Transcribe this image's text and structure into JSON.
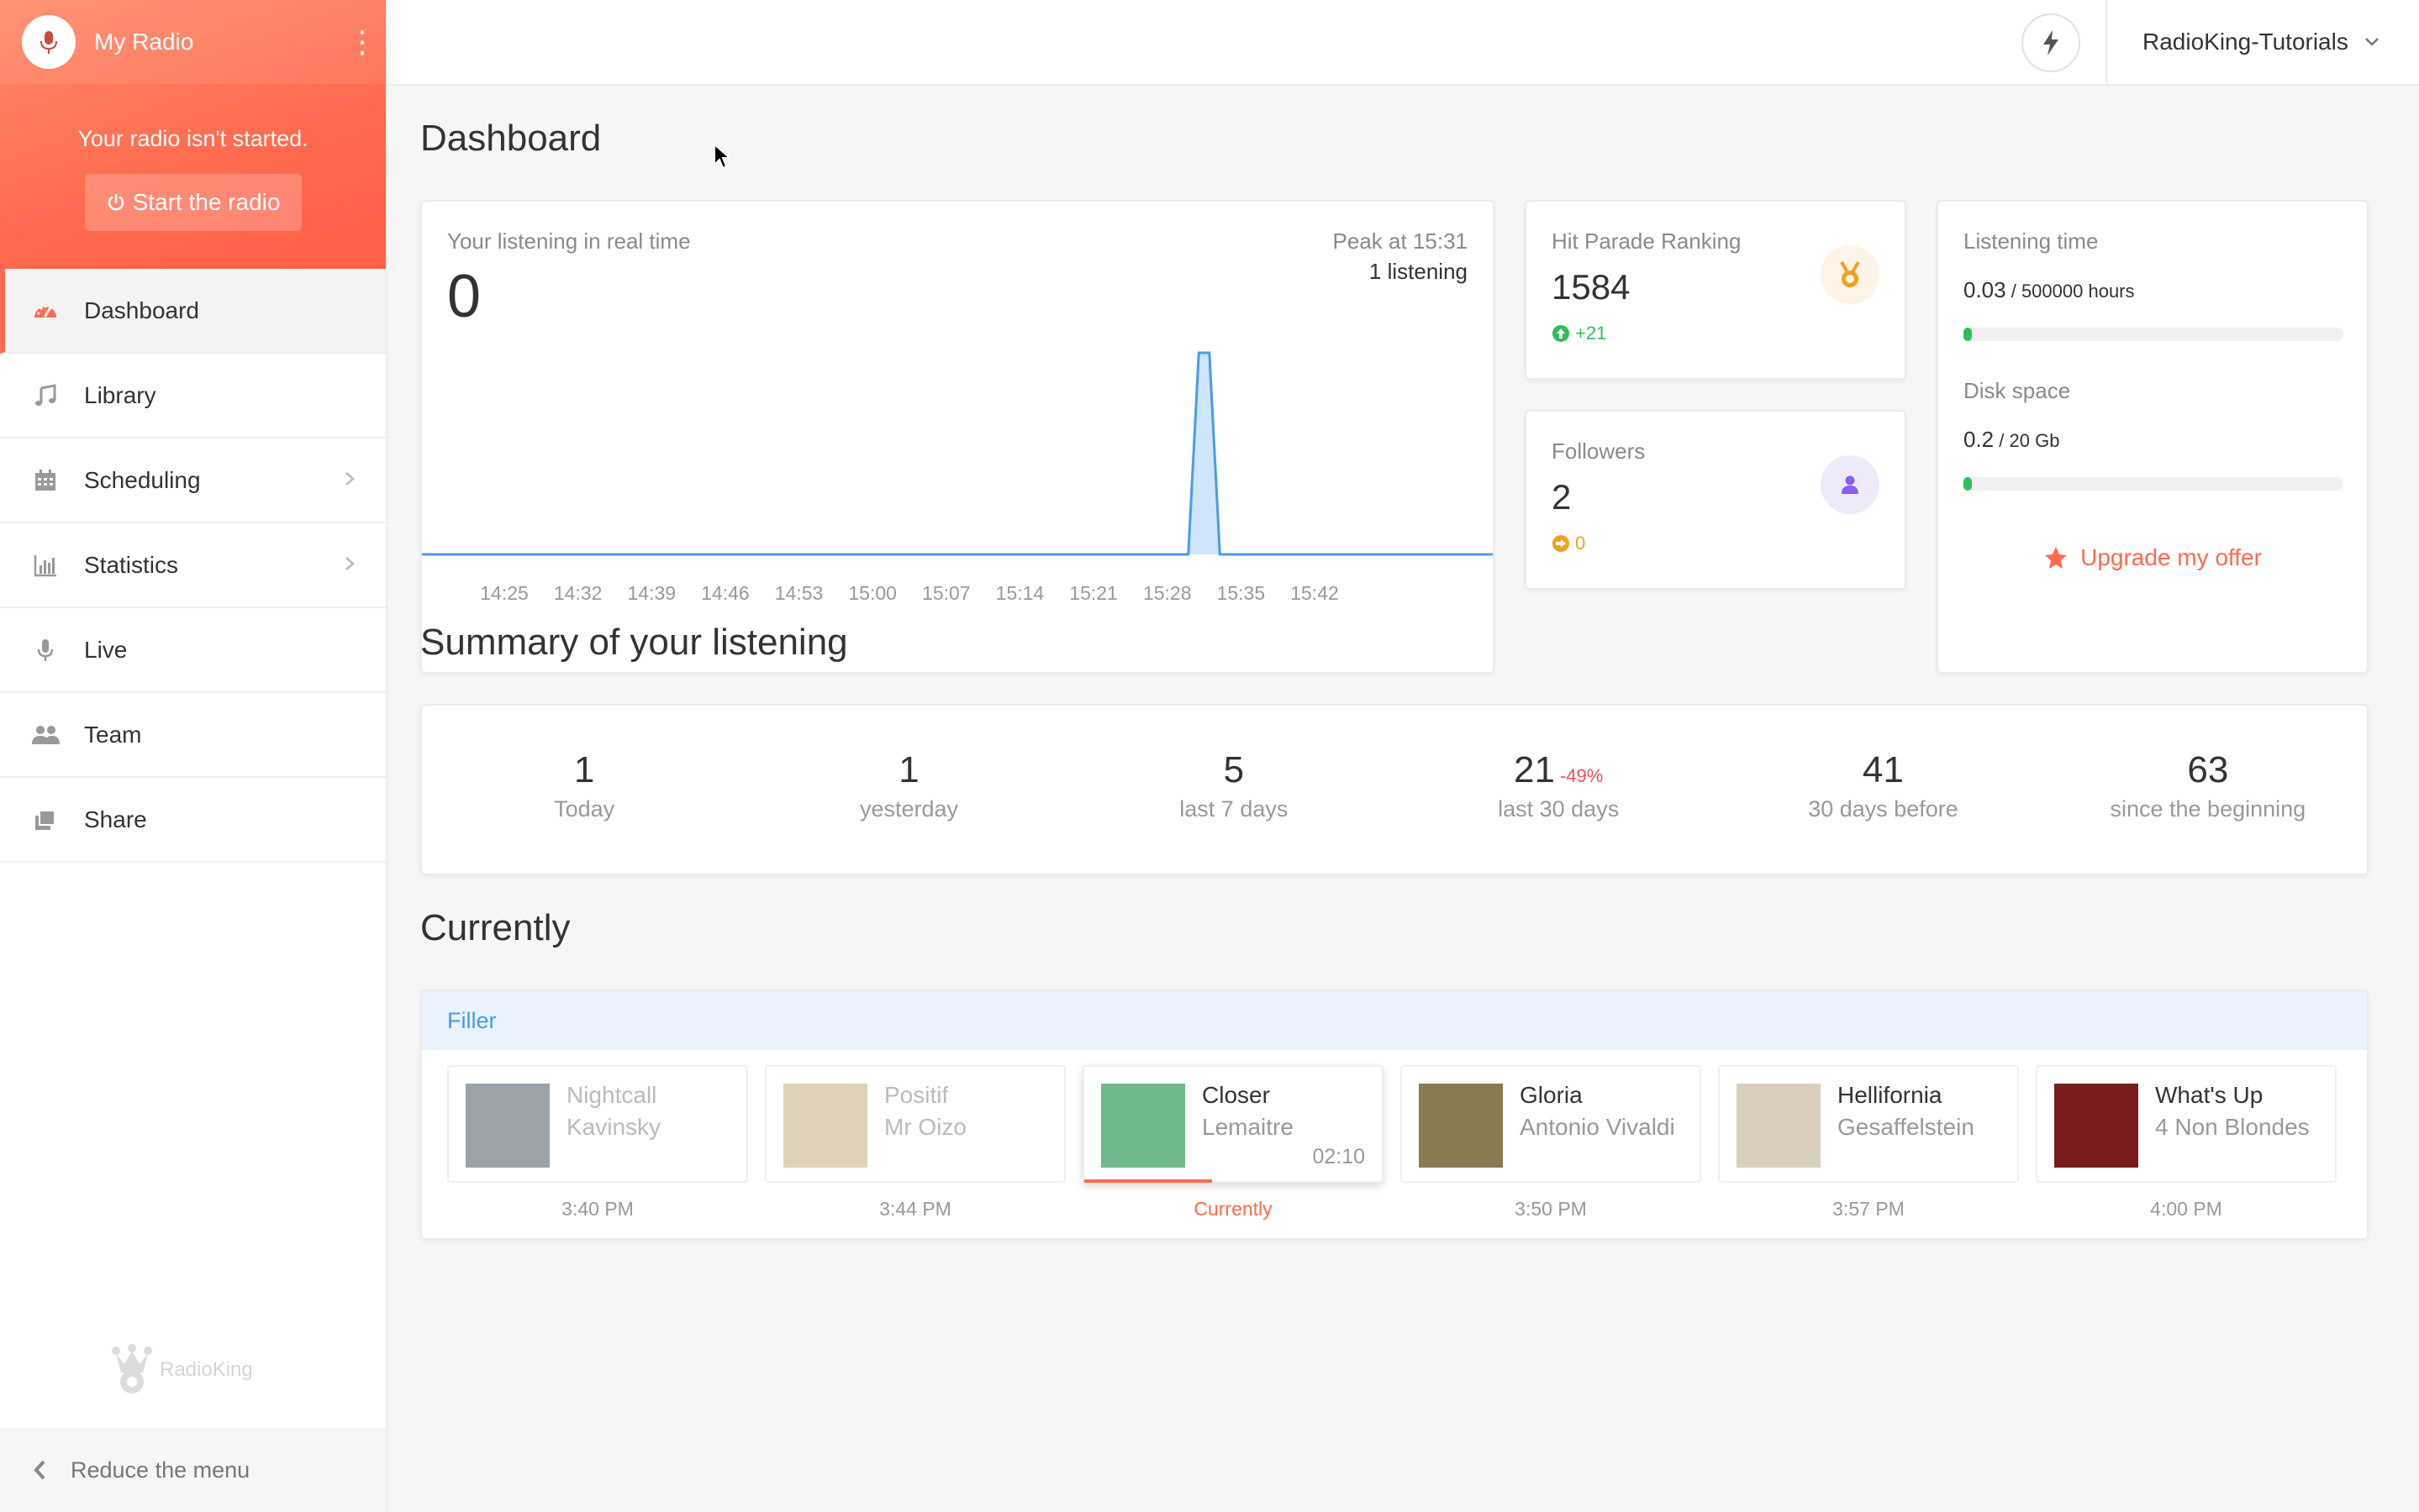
{
  "sidebar": {
    "title": "My Radio",
    "status_message": "Your radio isn't started.",
    "start_button": "Start the radio",
    "items": [
      {
        "label": "Dashboard",
        "icon": "dashboard-icon",
        "active": true
      },
      {
        "label": "Library",
        "icon": "music-note-icon"
      },
      {
        "label": "Scheduling",
        "icon": "calendar-icon",
        "has_submenu": true
      },
      {
        "label": "Statistics",
        "icon": "bar-chart-icon",
        "has_submenu": true
      },
      {
        "label": "Live",
        "icon": "microphone-icon"
      },
      {
        "label": "Team",
        "icon": "users-icon"
      },
      {
        "label": "Share",
        "icon": "share-icon"
      }
    ],
    "brand": "RadioKing",
    "reduce_label": "Reduce the menu"
  },
  "header": {
    "account_name": "RadioKing-Tutorials",
    "bolt_icon": "lightning-bolt-icon"
  },
  "dashboard": {
    "title": "Dashboard",
    "realtime": {
      "label": "Your listening in real time",
      "value": "0",
      "peak_label": "Peak at 15:31",
      "peak_value": "1 listening"
    },
    "hit_parade": {
      "label": "Hit Parade Ranking",
      "value": "1584",
      "change": "+21"
    },
    "followers": {
      "label": "Followers",
      "value": "2",
      "change": "0"
    },
    "listening_time": {
      "label": "Listening time",
      "value": "0.03",
      "unit": " / 500000 hours",
      "fraction": 6e-08
    },
    "disk_space": {
      "label": "Disk space",
      "value": "0.2",
      "unit": " / 20 Gb",
      "fraction": 0.01
    },
    "upgrade_label": "Upgrade my offer"
  },
  "summary": {
    "title": "Summary of your listening",
    "stats": [
      {
        "value": "1",
        "label": "Today"
      },
      {
        "value": "1",
        "label": "yesterday"
      },
      {
        "value": "5",
        "label": "last 7 days"
      },
      {
        "value": "21",
        "label": "last 30 days",
        "change": "-49%"
      },
      {
        "value": "41",
        "label": "30 days before"
      },
      {
        "value": "63",
        "label": "since the beginning"
      }
    ]
  },
  "currently": {
    "title": "Currently",
    "playlist": "Filler",
    "tracks": [
      {
        "title": "Nightcall",
        "artist": "Kavinsky",
        "time": "3:40 PM",
        "state": "past",
        "art_color": "#5a6470"
      },
      {
        "title": "Positif",
        "artist": "Mr Oizo",
        "time": "3:44 PM",
        "state": "past",
        "art_color": "#c9b48a"
      },
      {
        "title": "Closer",
        "artist": "Lemaitre",
        "time": "Currently",
        "state": "current",
        "duration": "02:10",
        "progress": 0.43,
        "art_color": "#6fb98c"
      },
      {
        "title": "Gloria",
        "artist": "Antonio Vivaldi",
        "time": "3:50 PM",
        "state": "fut",
        "art_color": "#8a7a50"
      },
      {
        "title": "Hellifornia",
        "artist": "Gesaffelstein",
        "time": "3:57 PM",
        "state": "fut",
        "art_color": "#d8cfbf"
      },
      {
        "title": "What's Up",
        "artist": "4 Non Blondes",
        "time": "4:00 PM",
        "state": "fut",
        "art_color": "#7a1d1d"
      }
    ]
  },
  "chart_data": {
    "type": "area",
    "x": [
      "14:25",
      "14:26",
      "14:27",
      "14:28",
      "14:29",
      "14:30",
      "14:31",
      "14:32",
      "14:33",
      "14:34",
      "14:35",
      "14:36",
      "14:37",
      "14:38",
      "14:39",
      "14:40",
      "14:41",
      "14:42",
      "14:43",
      "14:44",
      "14:45",
      "14:46",
      "14:47",
      "14:48",
      "14:49",
      "14:50",
      "14:51",
      "14:52",
      "14:53",
      "14:54",
      "14:55",
      "14:56",
      "14:57",
      "14:58",
      "14:59",
      "15:00",
      "15:01",
      "15:02",
      "15:03",
      "15:04",
      "15:05",
      "15:06",
      "15:07",
      "15:08",
      "15:09",
      "15:10",
      "15:11",
      "15:12",
      "15:13",
      "15:14",
      "15:15",
      "15:16",
      "15:17",
      "15:18",
      "15:19",
      "15:20",
      "15:21",
      "15:22",
      "15:23",
      "15:24",
      "15:25",
      "15:26",
      "15:27",
      "15:28",
      "15:29",
      "15:30",
      "15:31",
      "15:32",
      "15:33",
      "15:34",
      "15:35",
      "15:36",
      "15:37",
      "15:38",
      "15:39",
      "15:40",
      "15:41",
      "15:42",
      "15:43",
      "15:44",
      "15:45",
      "15:46"
    ],
    "values": [
      0,
      0,
      0,
      0,
      0,
      0,
      0,
      0,
      0,
      0,
      0,
      0,
      0,
      0,
      0,
      0,
      0,
      0,
      0,
      0,
      0,
      0,
      0,
      0,
      0,
      0,
      0,
      0,
      0,
      0,
      0,
      0,
      0,
      0,
      0,
      0,
      0,
      0,
      0,
      0,
      0,
      0,
      0,
      0,
      0,
      0,
      0,
      0,
      0,
      0,
      0,
      0,
      0,
      0,
      0,
      0,
      0,
      0,
      0,
      0,
      0,
      0,
      0,
      0,
      0,
      0,
      1,
      1,
      0,
      0,
      0,
      0,
      0,
      0,
      0,
      0,
      0,
      0,
      0,
      0,
      0,
      0
    ],
    "tick_labels": [
      "14:25",
      "14:32",
      "14:39",
      "14:46",
      "14:53",
      "15:00",
      "15:07",
      "15:14",
      "15:21",
      "15:28",
      "15:35",
      "15:42"
    ],
    "ylim": [
      0,
      1
    ],
    "colors": {
      "line": "#4a9be8",
      "fill": "#cfe5fb"
    }
  }
}
